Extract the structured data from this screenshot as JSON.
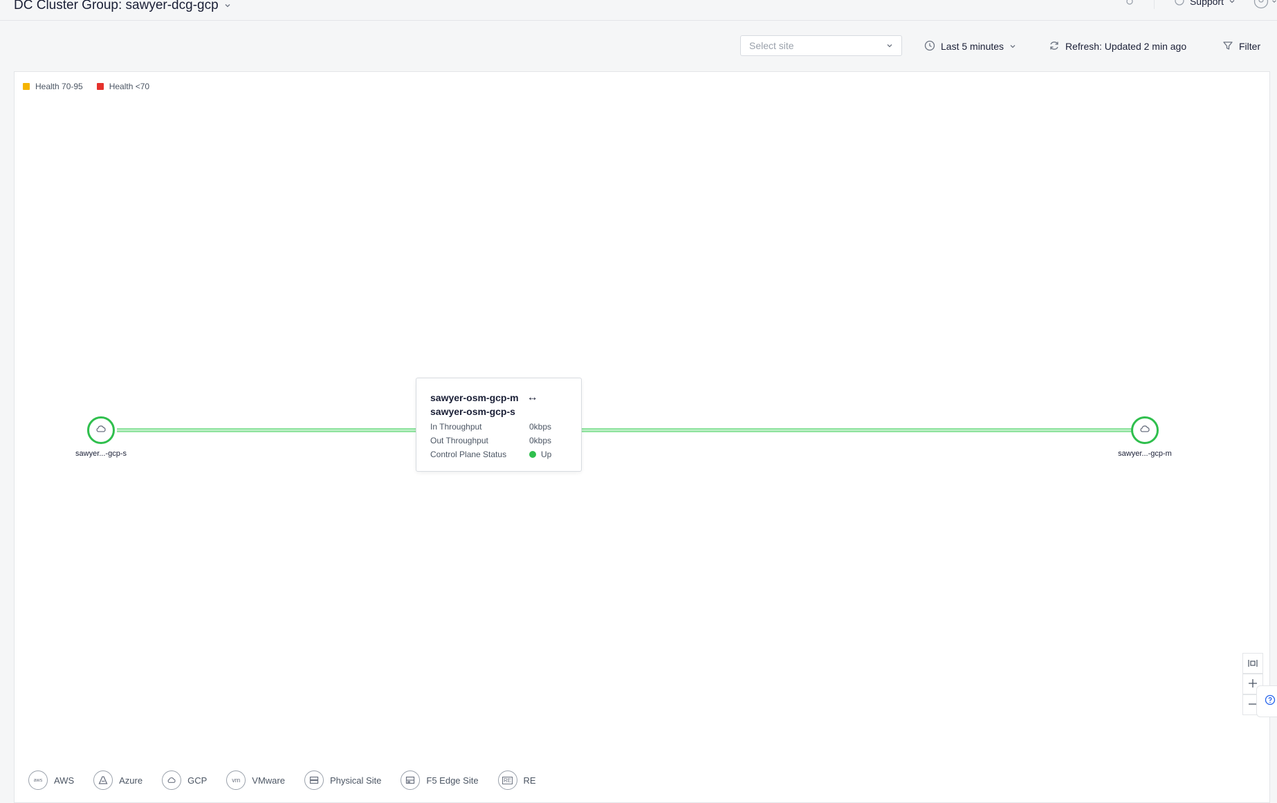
{
  "header": {
    "title": "DC Cluster Group: sawyer-dcg-gcp",
    "support_label": "Support"
  },
  "toolbar": {
    "site_placeholder": "Select site",
    "time_range": "Last 5 minutes",
    "refresh": "Refresh: Updated 2 min ago",
    "filter": "Filter"
  },
  "health_legend": [
    {
      "label": "Health 70-95",
      "color": "#f5b400"
    },
    {
      "label": "Health <70",
      "color": "#e5312c"
    }
  ],
  "topology": {
    "nodes": [
      {
        "label": "sawyer...-gcp-s",
        "icon": "gcp-cloud-icon"
      },
      {
        "label": "sawyer...-gcp-m",
        "icon": "gcp-cloud-icon"
      }
    ],
    "link_color": "#2fbf4d"
  },
  "tooltip": {
    "source": "sawyer-osm-gcp-m",
    "arrow": "↔",
    "target": "sawyer-osm-gcp-s",
    "rows": [
      {
        "key": "In Throughput",
        "value": "0kbps"
      },
      {
        "key": "Out Throughput",
        "value": "0kbps"
      },
      {
        "key": "Control Plane Status",
        "value": "Up"
      }
    ]
  },
  "providers": [
    {
      "label": "AWS",
      "icon": "aws-icon"
    },
    {
      "label": "Azure",
      "icon": "azure-icon"
    },
    {
      "label": "GCP",
      "icon": "gcp-icon"
    },
    {
      "label": "VMware",
      "icon": "vmware-icon"
    },
    {
      "label": "Physical Site",
      "icon": "physical-site-icon"
    },
    {
      "label": "F5 Edge Site",
      "icon": "f5-edge-site-icon"
    },
    {
      "label": "RE",
      "icon": "re-icon"
    }
  ],
  "provider_icon_text": {
    "aws": "aws",
    "vmware": "vm",
    "re": "RE"
  }
}
